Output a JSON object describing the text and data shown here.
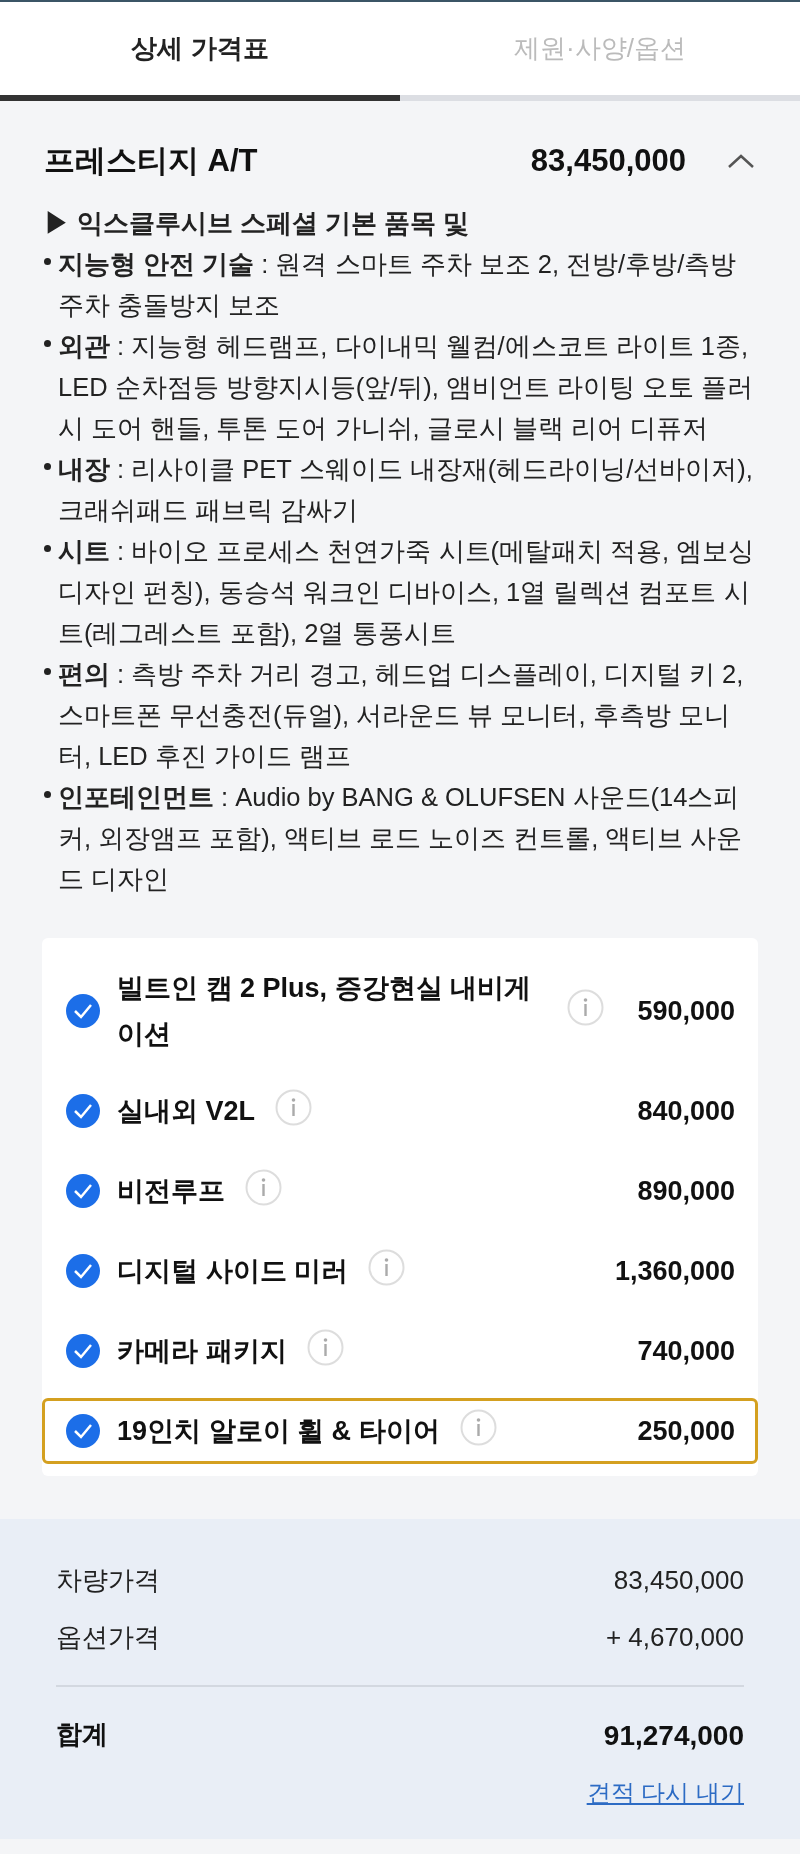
{
  "tabs": [
    {
      "label": "상세 가격표",
      "selected": true
    },
    {
      "label": "제원·사양/옵션",
      "selected": false
    }
  ],
  "trim": {
    "name": "프레스티지 A/T",
    "price": "83,450,000",
    "expanded": true
  },
  "description": {
    "heading": "▶ 익스클루시브 스페셜 기본 품목 및",
    "items": [
      "**지능형 안전 기술** : 원격 스마트 주차 보조 2, 전방/후방/측방 주차 충돌방지 보조",
      "**외관** : 지능형 헤드램프, 다이내믹 웰컴/에스코트 라이트 1종, LED 순차점등 방향지시등(앞/뒤), 앰비언트 라이팅 오토 플러시 도어 핸들, 투톤 도어 가니쉬, 글로시 블랙 리어 디퓨저",
      "**내장** : 리사이클 PET 스웨이드 내장재(헤드라이닝/선바이저), 크래쉬패드 패브릭 감싸기",
      "**시트** : 바이오 프로세스 천연가죽 시트(메탈패치 적용, 엠보싱 디자인 펀칭), 동승석 워크인 디바이스, 1열 릴렉션 컴포트 시트(레그레스트 포함), 2열 통풍시트",
      "**편의** : 측방 주차 거리 경고, 헤드업 디스플레이, 디지털 키 2, 스마트폰 무선충전(듀얼), 서라운드 뷰 모니터, 후측방 모니터, LED 후진 가이드 램프",
      "**인포테인먼트** : Audio by BANG & OLUFSEN 사운드(14스피커, 외장앰프 포함), 액티브 로드 노이즈 컨트롤, 액티브 사운드 디자인"
    ]
  },
  "options": [
    {
      "name": "빌트인 캠 2 Plus, 증강현실 내비게이션",
      "price": "590,000",
      "checked": true,
      "selected": false
    },
    {
      "name": "실내외 V2L",
      "price": "840,000",
      "checked": true,
      "selected": false
    },
    {
      "name": "비전루프",
      "price": "890,000",
      "checked": true,
      "selected": false
    },
    {
      "name": "디지털 사이드 미러",
      "price": "1,360,000",
      "checked": true,
      "selected": false
    },
    {
      "name": "카메라 패키지",
      "price": "740,000",
      "checked": true,
      "selected": false
    },
    {
      "name": "19인치 알로이 휠 & 타이어",
      "price": "250,000",
      "checked": true,
      "selected": true
    }
  ],
  "summary": {
    "rows": [
      {
        "label": "차량가격",
        "value": "83,450,000"
      },
      {
        "label": "옵션가격",
        "value": "+ 4,670,000"
      }
    ],
    "total": {
      "label": "합계",
      "value": "91,274,000"
    },
    "link": "견적 다시 내기"
  }
}
